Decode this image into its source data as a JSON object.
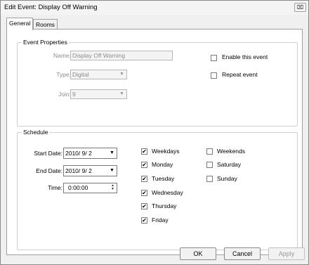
{
  "window": {
    "title": "Edit Event: Display Off Warning",
    "close_glyph": "⌧"
  },
  "tabs": [
    {
      "label": "General"
    },
    {
      "label": "Rooms"
    }
  ],
  "event_properties": {
    "legend": "Event Properties",
    "name_label": "Name:",
    "name_value": "Display Off Warning",
    "type_label": "Type:",
    "type_value": "Digital",
    "join_label": "Join:",
    "join_value": "9",
    "enable_label": "Enable this event",
    "enable_checked": false,
    "repeat_label": "Repeat event",
    "repeat_checked": false
  },
  "schedule": {
    "legend": "Schedule",
    "start_date_label": "Start Date:",
    "start_date_value": "2010/ 9/ 2",
    "end_date_label": "End Date:",
    "end_date_value": "2010/ 9/ 2",
    "time_label": "Time:",
    "time_value": "0:00:00",
    "days_left": [
      {
        "label": "Weekdays",
        "checked": true
      },
      {
        "label": "Monday",
        "checked": true
      },
      {
        "label": "Tuesday",
        "checked": true
      },
      {
        "label": "Wednesday",
        "checked": true
      },
      {
        "label": "Thursday",
        "checked": true
      },
      {
        "label": "Friday",
        "checked": true
      }
    ],
    "days_right": [
      {
        "label": "Weekends",
        "checked": false
      },
      {
        "label": "Saturday",
        "checked": false
      },
      {
        "label": "Sunday",
        "checked": false
      }
    ]
  },
  "buttons": {
    "ok": "OK",
    "cancel": "Cancel",
    "apply": "Apply"
  },
  "glyphs": {
    "dropdown": "▼",
    "check": "✔",
    "spin_up": "▲",
    "spin_down": "▼"
  }
}
